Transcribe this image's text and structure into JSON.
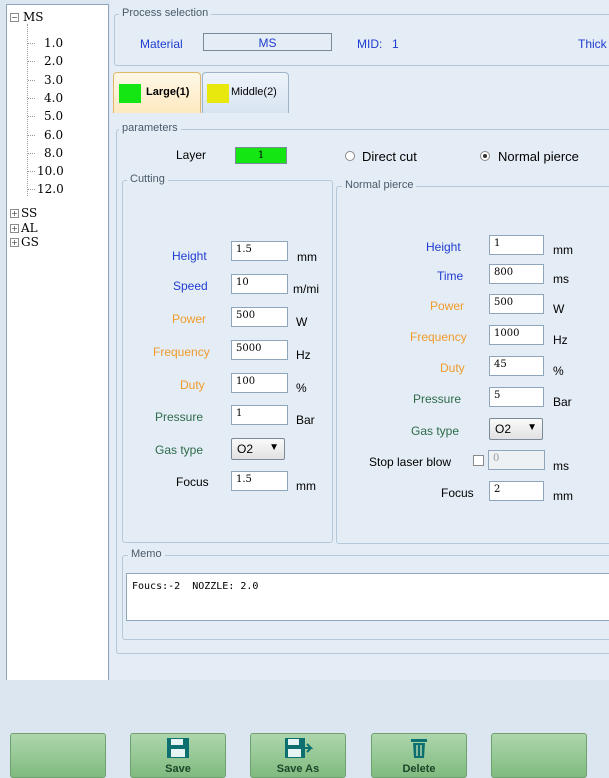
{
  "tree": {
    "ms_label": "MS",
    "ms_children": [
      "1.0",
      "2.0",
      "3.0",
      "4.0",
      "5.0",
      "6.0",
      "8.0",
      "10.0",
      "12.0"
    ],
    "ss_label": "SS",
    "al_label": "AL",
    "gs_label": "GS"
  },
  "process": {
    "legend": "Process selection",
    "material_label": "Material",
    "material_value": "MS",
    "mid_label": "MID:",
    "mid_value": "1",
    "thickness_label": "Thick"
  },
  "tabs": [
    {
      "label": "Large(1)",
      "color": "#14e614",
      "selected": true
    },
    {
      "label": "Middle(2)",
      "color": "#e8e80e",
      "selected": false
    }
  ],
  "parameters": {
    "legend": "parameters",
    "layer_label": "Layer",
    "layer_value": "1",
    "direct_cut_label": "Direct cut",
    "normal_pierce_label": "Normal pierce",
    "selected_mode": "Normal pierce"
  },
  "cutting": {
    "legend": "Cutting",
    "height": {
      "label": "Height",
      "value": "1.5",
      "unit": "mm"
    },
    "speed": {
      "label": "Speed",
      "value": "10",
      "unit": "m/mi"
    },
    "power": {
      "label": "Power",
      "value": "500",
      "unit": "W"
    },
    "frequency": {
      "label": "Frequency",
      "value": "5000",
      "unit": "Hz"
    },
    "duty": {
      "label": "Duty",
      "value": "100",
      "unit": "%"
    },
    "pressure": {
      "label": "Pressure",
      "value": "1",
      "unit": "Bar"
    },
    "gas_type": {
      "label": "Gas type",
      "value": "O2"
    },
    "focus": {
      "label": "Focus",
      "value": "1.5",
      "unit": "mm"
    }
  },
  "pierce": {
    "legend": "Normal pierce",
    "height": {
      "label": "Height",
      "value": "1",
      "unit": "mm"
    },
    "time": {
      "label": "Time",
      "value": "800",
      "unit": "ms"
    },
    "power": {
      "label": "Power",
      "value": "500",
      "unit": "W"
    },
    "frequency": {
      "label": "Frequency",
      "value": "1000",
      "unit": "Hz"
    },
    "duty": {
      "label": "Duty",
      "value": "45",
      "unit": "%"
    },
    "pressure": {
      "label": "Pressure",
      "value": "5",
      "unit": "Bar"
    },
    "gas_type": {
      "label": "Gas type",
      "value": "O2"
    },
    "stop_laser_blow": {
      "label": "Stop laser blow",
      "value": "0",
      "unit": "ms"
    },
    "focus": {
      "label": "Focus",
      "value": "2",
      "unit": "mm"
    }
  },
  "memo": {
    "legend": "Memo",
    "text": "Foucs:-2  NOZZLE: 2.0"
  },
  "buttons": {
    "save": "Save",
    "save_as": "Save As",
    "delete": "Delete"
  },
  "colors": {
    "label_blue": "#1f3cd1",
    "label_orange": "#f09a2c",
    "label_green": "#2d6b4a",
    "button_green": "#8cc48b"
  }
}
